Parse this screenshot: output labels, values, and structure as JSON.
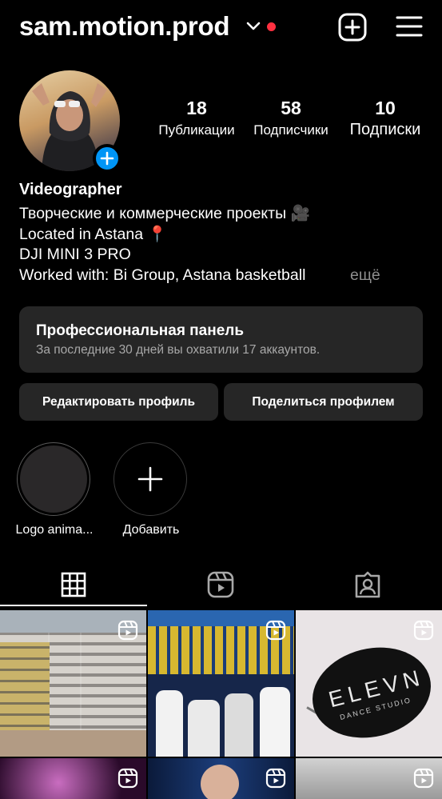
{
  "header": {
    "username": "sam.motion.prod",
    "notification_dot_color": "#ff3040",
    "create_icon": "plus-square-icon",
    "menu_icon": "hamburger-menu-icon"
  },
  "stats": {
    "posts_count": "18",
    "posts_label": "Публикации",
    "followers_count": "58",
    "followers_label": "Подписчики",
    "following_count": "10",
    "following_label": "Подписки"
  },
  "bio": {
    "name": "Videographer",
    "line1": "Творческие и коммерческие проекты 🎥",
    "line2": "Located in Astana 📍",
    "line3": "DJI MINI 3 PRO",
    "line4": "Worked with: Bi Group, Astana basketball",
    "more": "ещё"
  },
  "dashboard": {
    "title": "Профессиональная панель",
    "subtitle": "За последние 30 дней вы охватили 17 аккаунтов."
  },
  "buttons": {
    "edit": "Редактировать профиль",
    "share": "Поделиться профилем"
  },
  "highlights": [
    {
      "label": "Logo anima..."
    },
    {
      "label": "Добавить"
    }
  ],
  "tabs": {
    "grid_icon": "grid-icon",
    "reels_icon": "reels-icon",
    "tagged_icon": "tagged-icon",
    "active": "grid"
  },
  "posts": {
    "tile3_text": "ELEVN",
    "tile3_subtext": "DANCE STUDIO"
  },
  "colors": {
    "accent": "#0095f6",
    "panel": "#262626",
    "muted": "#8e8e8e"
  }
}
